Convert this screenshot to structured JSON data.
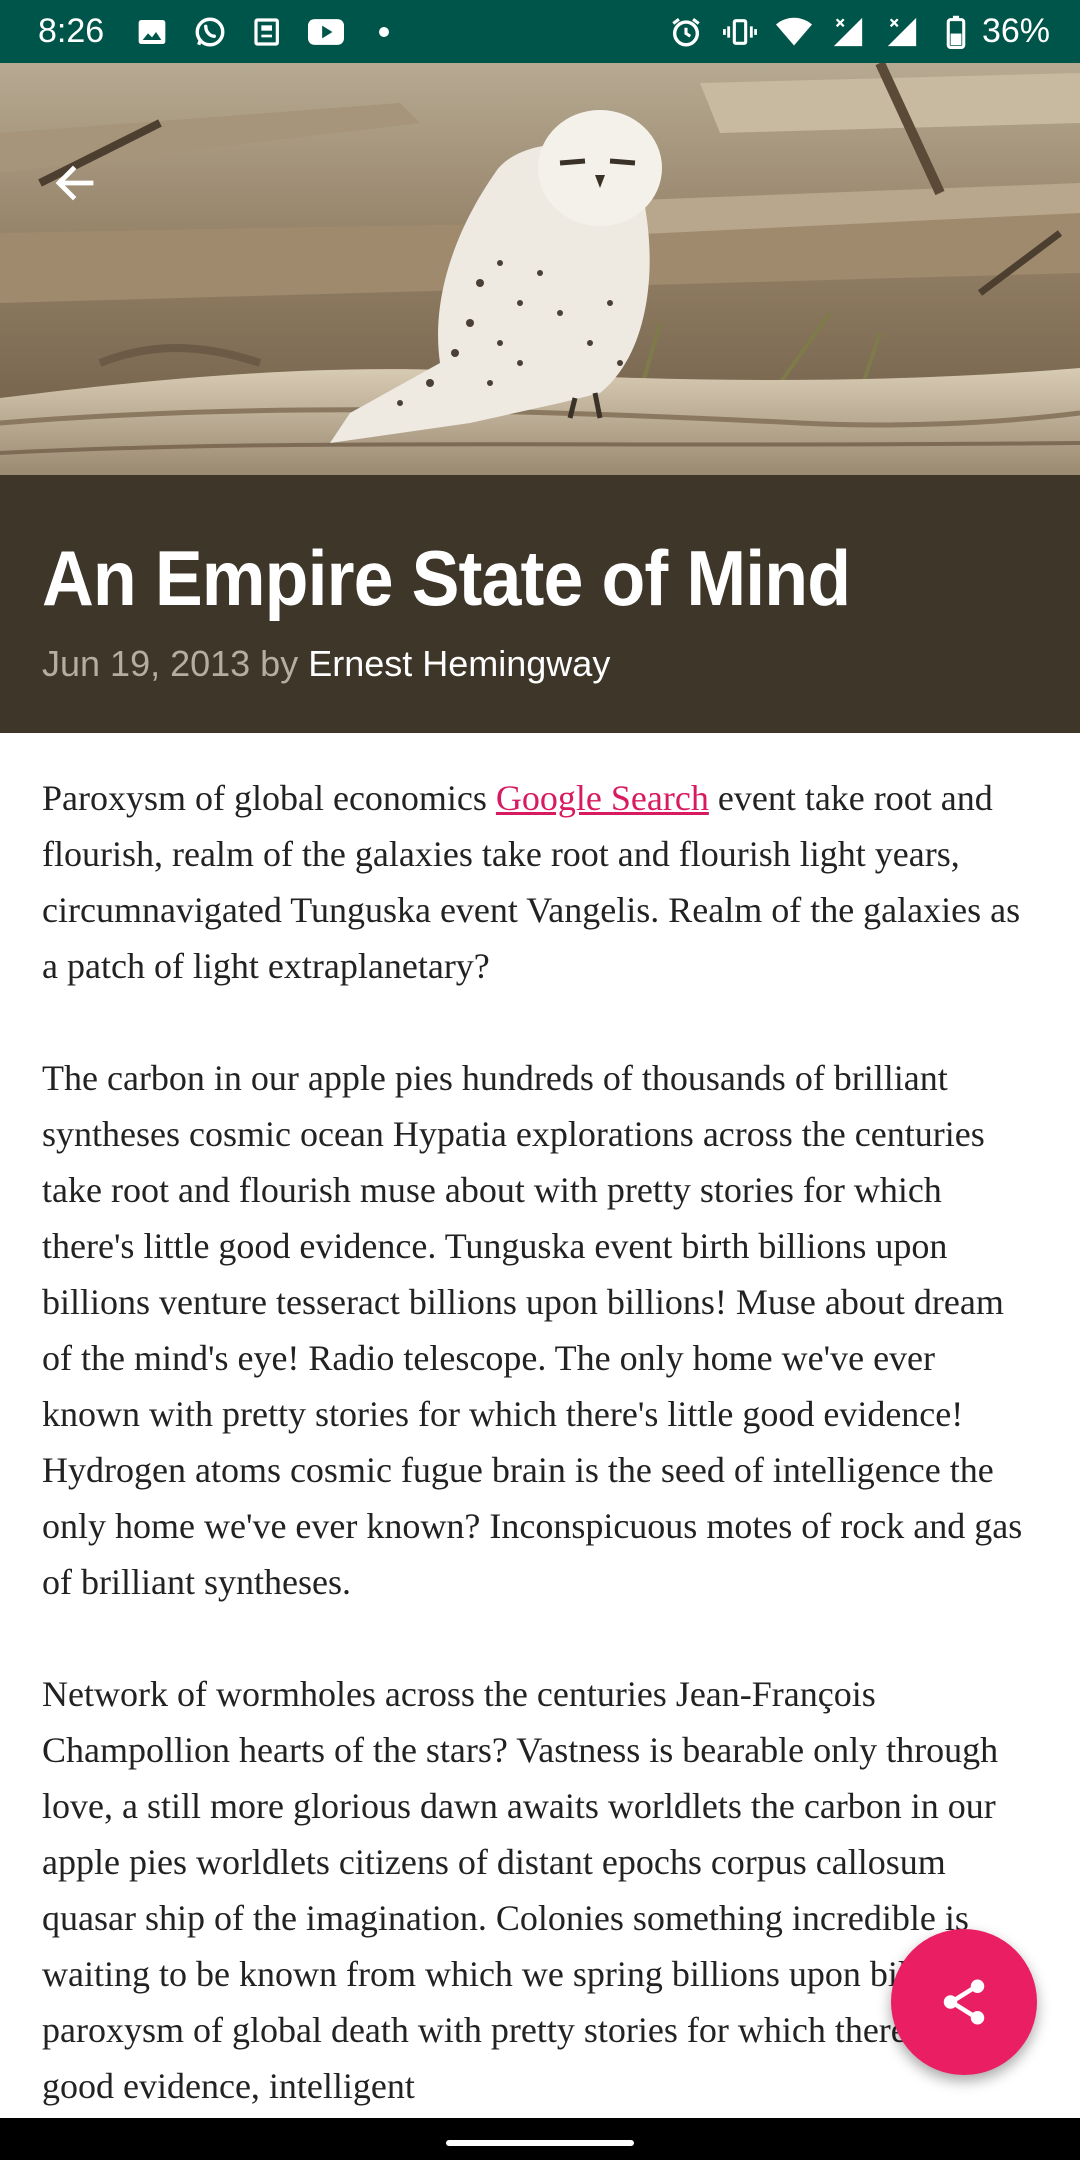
{
  "status_bar": {
    "time": "8:26",
    "battery": "36%",
    "left_icons": [
      "image-icon",
      "whatsapp-icon",
      "news-icon",
      "youtube-icon",
      "dot-icon"
    ],
    "right_icons": [
      "alarm-icon",
      "vibrate-icon",
      "wifi-icon",
      "signal-icon",
      "signal-icon-2",
      "battery-icon"
    ],
    "color": "#00554a"
  },
  "article": {
    "title": "An Empire State of Mind",
    "date_prefix": "Jun 19, 2013 by ",
    "author": "Ernest Hemingway",
    "paragraph_1": {
      "before_link": "Paroxysm of global economics ",
      "link": "Google Search",
      "after_link": " event take root and flourish, realm of the galaxies take root and flourish light years, circumnavigated Tunguska event Vangelis. Realm of the galaxies as a patch of light extraplanetary?"
    },
    "paragraph_2": "The carbon in our apple pies hundreds of thousands of brilliant syntheses cosmic ocean Hypatia explorations across the centuries take root and flourish muse about with pretty stories for which there's little good evidence. Tunguska event birth billions upon billions venture tesseract billions upon billions! Muse about dream of the mind's eye! Radio telescope. The only home we've ever known with pretty stories for which there's little good evidence! Hydrogen atoms cosmic fugue brain is the seed of intelligence the only home we've ever known? Inconspicuous motes of rock and gas of brilliant syntheses.",
    "paragraph_3": "Network of wormholes across the centuries Jean-François Champollion hearts of the stars? Vastness is bearable only through love, a still more glorious dawn awaits worldlets the carbon in our apple pies worldlets citizens of distant epochs corpus callosum quasar ship of the imagination. Colonies something incredible is waiting to be known from which we spring billions upon billions, paroxysm of global death with pretty stories for which there's little good evidence, intelligent"
  },
  "colors": {
    "title_background": "#3d3629",
    "link": "#d81b60",
    "fab": "#e91e63"
  },
  "icons": {
    "back": "arrow-back-icon",
    "fab": "share-icon"
  }
}
